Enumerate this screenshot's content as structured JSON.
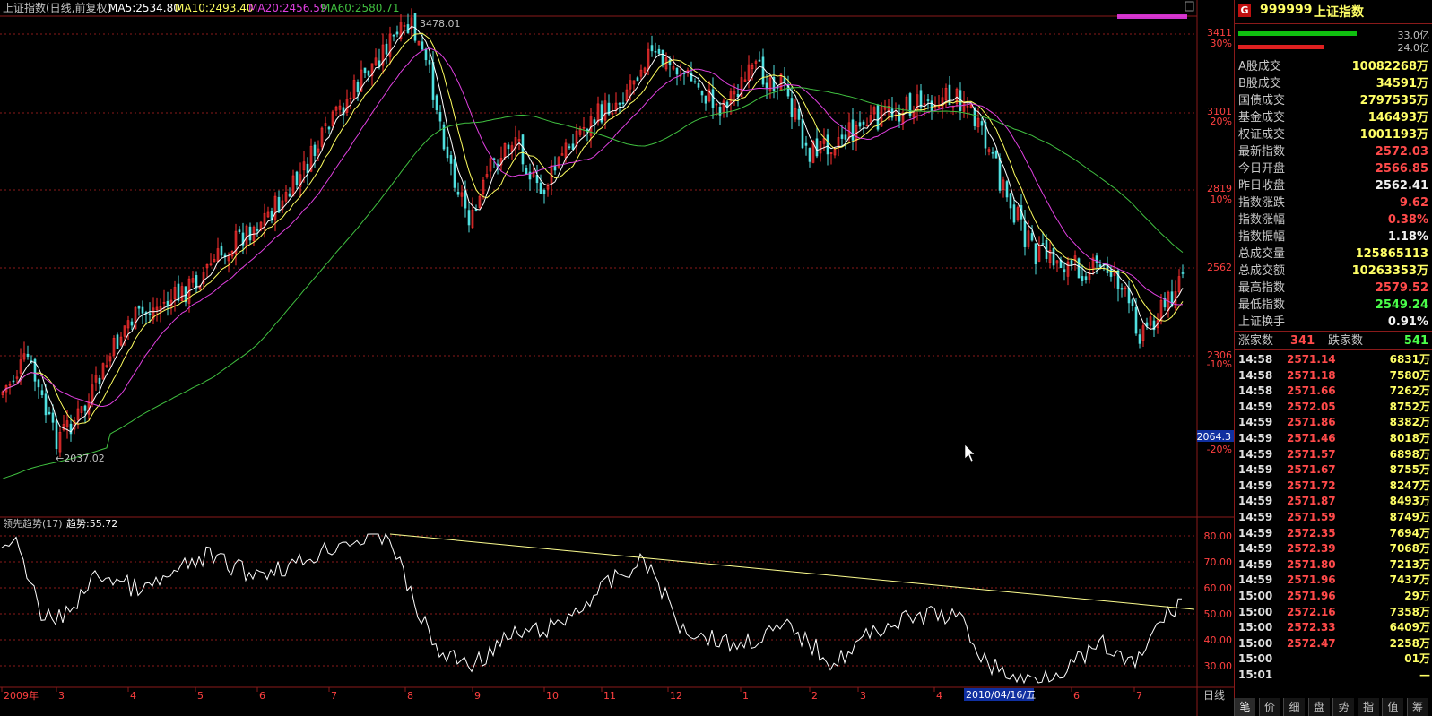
{
  "header": {
    "title": "上证指数(日线,前复权)",
    "ma5": "MA5:2534.80",
    "ma10": "MA10:2493.40",
    "ma20": "MA20:2456.59",
    "ma60": "MA60:2580.71"
  },
  "annotations": {
    "high": "3478.01",
    "low": "←2037.02"
  },
  "price_axis": {
    "ticks": [
      {
        "label": "3411",
        "pct": "30%"
      },
      {
        "label": "3101",
        "pct": "20%"
      },
      {
        "label": "2819",
        "pct": "10%"
      },
      {
        "label": "2562",
        "pct": ""
      },
      {
        "label": "2306",
        "pct": "-10%"
      },
      {
        "label": "",
        "pct": "-20%"
      }
    ],
    "cursor_value": "2064.3"
  },
  "indicator": {
    "title": "领先趋势(17)",
    "value_label": "趋势:55.72",
    "ticks": [
      "80.00",
      "70.00",
      "60.00",
      "50.00",
      "40.00",
      "30.00"
    ]
  },
  "time_axis": {
    "labels": [
      "2009年",
      "3",
      "4",
      "5",
      "6",
      "7",
      "8",
      "9",
      "10",
      "11",
      "12",
      "1",
      "2",
      "3",
      "4",
      "5",
      "6",
      "7"
    ],
    "cursor_date": "2010/04/16/五",
    "period": "日线"
  },
  "panel": {
    "code": "999999",
    "name": "上证指数",
    "badge": "G",
    "bar_values": [
      "33.0亿",
      "24.0亿"
    ],
    "rows": [
      {
        "label": "A股成交",
        "value": "10082268万",
        "color": "yel"
      },
      {
        "label": "B股成交",
        "value": "34591万",
        "color": "yel"
      },
      {
        "label": "国债成交",
        "value": "2797535万",
        "color": "yel"
      },
      {
        "label": "基金成交",
        "value": "146493万",
        "color": "yel"
      },
      {
        "label": "权证成交",
        "value": "1001193万",
        "color": "yel"
      },
      {
        "label": "最新指数",
        "value": "2572.03",
        "color": "red"
      },
      {
        "label": "今日开盘",
        "value": "2566.85",
        "color": "red"
      },
      {
        "label": "昨日收盘",
        "value": "2562.41",
        "color": "wht"
      },
      {
        "label": "指数涨跌",
        "value": "9.62",
        "color": "red"
      },
      {
        "label": "指数涨幅",
        "value": "0.38%",
        "color": "red"
      },
      {
        "label": "指数振幅",
        "value": "1.18%",
        "color": "wht"
      },
      {
        "label": "总成交量",
        "value": "125865113",
        "color": "yel"
      },
      {
        "label": "总成交额",
        "value": "10263353万",
        "color": "yel"
      },
      {
        "label": "最高指数",
        "value": "2579.52",
        "color": "red"
      },
      {
        "label": "最低指数",
        "value": "2549.24",
        "color": "grn"
      },
      {
        "label": "上证换手",
        "value": "0.91%",
        "color": "wht"
      }
    ],
    "advance_label": "涨家数",
    "advance_value": "341",
    "decline_label": "跌家数",
    "decline_value": "541",
    "ticks": [
      {
        "time": "14:58",
        "price": "2571.14",
        "vol": "6831万"
      },
      {
        "time": "14:58",
        "price": "2571.18",
        "vol": "7580万"
      },
      {
        "time": "14:58",
        "price": "2571.66",
        "vol": "7262万"
      },
      {
        "time": "14:59",
        "price": "2572.05",
        "vol": "8752万"
      },
      {
        "time": "14:59",
        "price": "2571.86",
        "vol": "8382万"
      },
      {
        "time": "14:59",
        "price": "2571.46",
        "vol": "8018万"
      },
      {
        "time": "14:59",
        "price": "2571.57",
        "vol": "6898万"
      },
      {
        "time": "14:59",
        "price": "2571.67",
        "vol": "8755万"
      },
      {
        "time": "14:59",
        "price": "2571.72",
        "vol": "8247万"
      },
      {
        "time": "14:59",
        "price": "2571.87",
        "vol": "8493万"
      },
      {
        "time": "14:59",
        "price": "2571.59",
        "vol": "8749万"
      },
      {
        "time": "14:59",
        "price": "2572.35",
        "vol": "7694万"
      },
      {
        "time": "14:59",
        "price": "2572.39",
        "vol": "7068万"
      },
      {
        "time": "14:59",
        "price": "2571.80",
        "vol": "7213万"
      },
      {
        "time": "14:59",
        "price": "2571.96",
        "vol": "7437万"
      },
      {
        "time": "15:00",
        "price": "2571.96",
        "vol": "29万"
      },
      {
        "time": "15:00",
        "price": "2572.16",
        "vol": "7358万"
      },
      {
        "time": "15:00",
        "price": "2572.33",
        "vol": "6409万"
      },
      {
        "time": "15:00",
        "price": "2572.47",
        "vol": "2258万"
      },
      {
        "time": "15:00",
        "price": "",
        "vol": "01万"
      },
      {
        "time": "15:01",
        "price": "",
        "vol": "—"
      }
    ],
    "tabs": [
      "笔",
      "价",
      "细",
      "盘",
      "势",
      "指",
      "值",
      "筹"
    ]
  },
  "colors": {
    "up": "#ff3030",
    "down": "#50e0e0",
    "ma5": "#ffffff",
    "ma10": "#ffff60",
    "ma20": "#e040e0",
    "ma60": "#40c040",
    "grid": "#8a1a1a"
  }
}
